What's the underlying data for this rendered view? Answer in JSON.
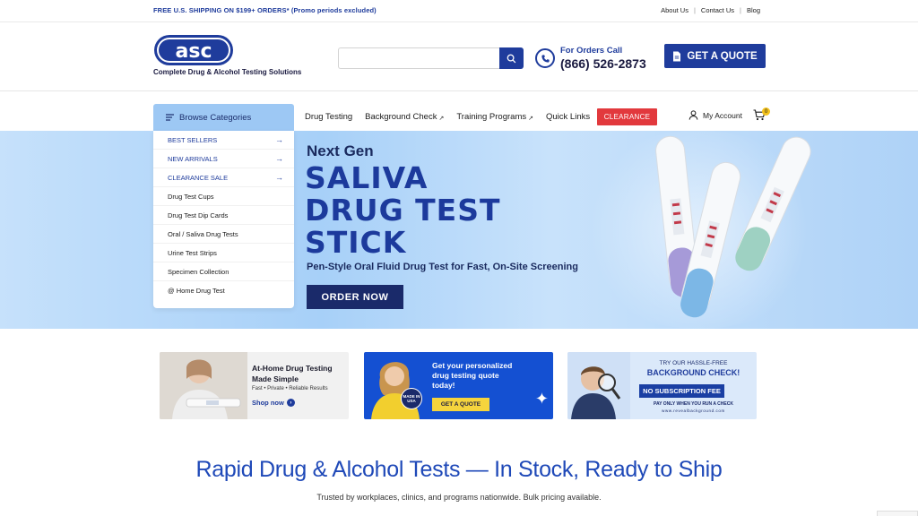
{
  "topbar": {
    "promo": "FREE U.S. SHIPPING ON $199+ ORDERS* (Promo periods excluded)",
    "links": [
      "About Us",
      "Contact Us",
      "Blog"
    ]
  },
  "header": {
    "logo_text": "asc",
    "tagline": "Complete Drug & Alcohol Testing Solutions",
    "search_placeholder": "",
    "phone_label": "For Orders Call",
    "phone_number": "(866) 526-2873",
    "quote_button": "GET A QUOTE"
  },
  "nav": {
    "browse": "Browse Categories",
    "items": [
      {
        "label": "Drug Testing",
        "arrow": ""
      },
      {
        "label": "Background Check",
        "arrow": "↗"
      },
      {
        "label": "Training Programs",
        "arrow": "↗"
      },
      {
        "label": "Quick Links",
        "arrow": ""
      }
    ],
    "clearance": "CLEARANCE",
    "account": "My Account",
    "cart_count": "0"
  },
  "categories": [
    {
      "label": "BEST SELLERS",
      "highlight": true
    },
    {
      "label": "NEW ARRIVALS",
      "highlight": true
    },
    {
      "label": "CLEARANCE SALE",
      "highlight": true
    },
    {
      "label": "Drug Test Cups",
      "highlight": false
    },
    {
      "label": "Drug Test Dip Cards",
      "highlight": false
    },
    {
      "label": "Oral / Saliva Drug Tests",
      "highlight": false
    },
    {
      "label": "Urine Test Strips",
      "highlight": false
    },
    {
      "label": "Specimen Collection",
      "highlight": false
    },
    {
      "label": "@ Home Drug Test",
      "highlight": false
    }
  ],
  "hero": {
    "eyebrow": "Next Gen",
    "title_lines": [
      "SALIVA",
      "DRUG TEST",
      "STICK"
    ],
    "tagline": "Pen-Style Oral Fluid Drug Test for Fast, On-Site Screening",
    "cta": "ORDER NOW"
  },
  "promos": {
    "home": {
      "line1": "At-Home Drug Testing",
      "line2": "Made Simple",
      "features": "Fast • Private • Reliable Results",
      "cta": "Shop now"
    },
    "quote": {
      "line1": "Get your personalized",
      "line2": "drug testing quote",
      "line3": "today!",
      "badge": "MADE IN USA",
      "cta": "GET A QUOTE"
    },
    "background": {
      "line1": "TRY OUR HASSLE-FREE",
      "line2": "BACKGROUND CHECK!",
      "pill": "NO SUBSCRIPTION FEE",
      "line3": "PAY ONLY WHEN YOU RUN A CHECK",
      "url": "www.revealbackground.com"
    }
  },
  "section": {
    "title": "Rapid Drug & Alcohol Tests — In Stock, Ready to Ship",
    "subtitle": "Trusted by workplaces, clinics, and programs nationwide. Bulk pricing available."
  }
}
